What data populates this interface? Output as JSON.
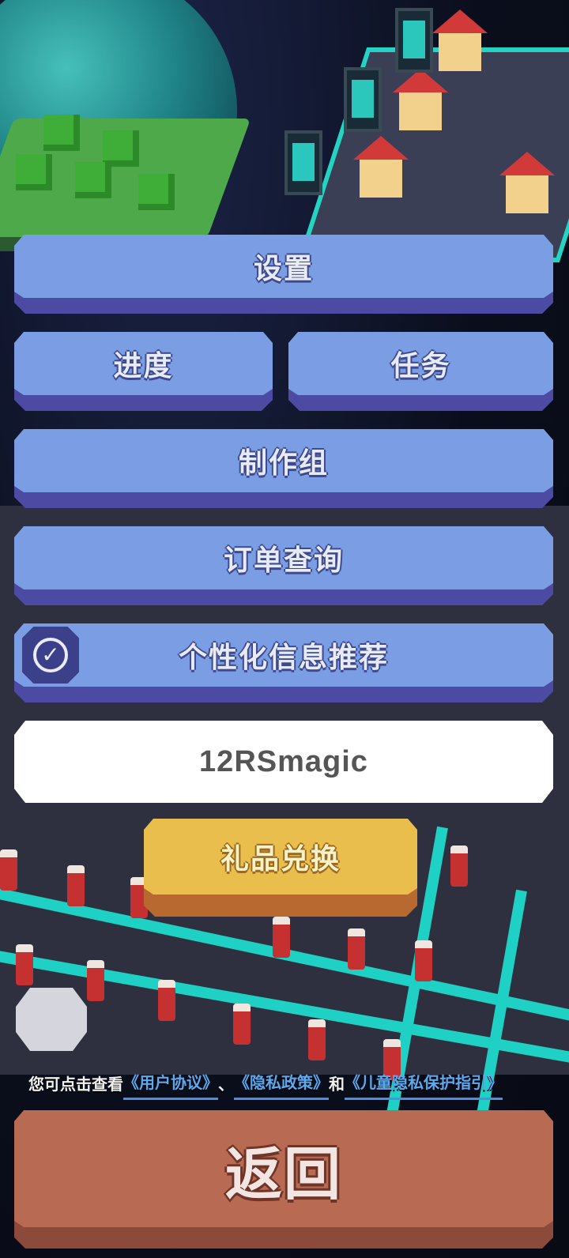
{
  "menu": {
    "settings_label": "设置",
    "progress_label": "进度",
    "tasks_label": "任务",
    "credits_label": "制作组",
    "orders_label": "订单查询",
    "personalized_label": "个性化信息推荐",
    "personalized_checked": true
  },
  "redeem": {
    "code_value": "12RSmagic",
    "button_label": "礼品兑换"
  },
  "agreement": {
    "prefix": "您可点击查看",
    "user_agreement": "《用户协议》",
    "separator": "、",
    "privacy_policy": "《隐私政策》",
    "and": "和",
    "child_privacy": "《儿童隐私保护指引》"
  },
  "back_label": "返回",
  "colors": {
    "menu_button": "#7a9de3",
    "menu_button_side": "#4d4aa3",
    "gift_button": "#e9be4c",
    "back_button": "#b86a52",
    "link": "#5ca9f0"
  },
  "icons": {
    "personalized_toggle": "check-circle-icon"
  }
}
